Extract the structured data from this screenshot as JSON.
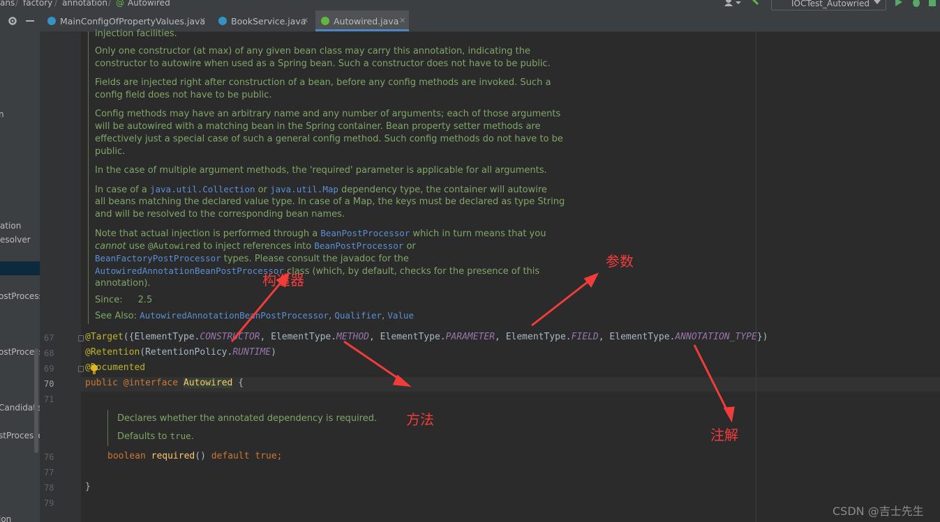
{
  "breadcrumb": [
    "ans",
    "factory",
    "annotation",
    "Autowired"
  ],
  "run_config": "IOCTest_Autowried",
  "tabs": [
    {
      "label": "MainConfigOfPropertyValues.java",
      "icon_color": "#3592c4",
      "active": false
    },
    {
      "label": "BookService.java",
      "icon_color": "#3592c4",
      "active": false
    },
    {
      "label": "Autowired.java",
      "icon_color": "#62b543",
      "active": true
    }
  ],
  "project_panel": {
    "items": [
      "n",
      "ation",
      "esolver",
      "ostProcesso",
      "ostProcesso",
      "CandidateR",
      "stProcesso",
      "ion"
    ]
  },
  "javadoc": {
    "line0": "injection facilities.",
    "p1": [
      "Only one constructor (at max) of any given bean class may carry this annotation, indicating the",
      "constructor to autowire when used as a Spring bean. Such a constructor does not have to be public."
    ],
    "p2": [
      "Fields are injected right after construction of a bean, before any config methods are invoked. Such a",
      "config field does not have to be public."
    ],
    "p3": [
      "Config methods may have an arbitrary name and any number of arguments; each of those arguments",
      "will be autowired with a matching bean in the Spring container. Bean property setter methods are",
      "effectively just a special case of such a general config method. Such config methods do not have to be",
      "public."
    ],
    "p4": "In the case of multiple argument methods, the 'required' parameter is applicable for all arguments.",
    "p5": {
      "a": "In case of a ",
      "b": "java.util.Collection",
      "c": " or ",
      "d": "java.util.Map",
      "e": " dependency type, the container will autowire",
      "l2": "all beans matching the declared value type. In case of a Map, the keys must be declared as type String",
      "l3": "and will be resolved to the corresponding bean names."
    },
    "p6": {
      "a": "Note that actual injection is performed through a ",
      "b": "BeanPostProcessor",
      "c": " which in turn means that you",
      "d": "cannot",
      "e": " use ",
      "f": "@Autowired",
      "g": " to inject references into ",
      "h": "BeanPostProcessor",
      "i": " or",
      "j": "BeanFactoryPostProcessor",
      "k": " types. Please consult the javadoc for the",
      "l": "AutowiredAnnotationBeanPostProcessor",
      "m": " class (which, by default, checks for the presence of this",
      "n": "annotation)."
    },
    "since_label": "Since:",
    "since_value": "2.5",
    "see_label": "See Also:",
    "see_links": [
      "AutowiredAnnotationBeanPostProcessor",
      "Qualifier",
      "Value"
    ]
  },
  "code": {
    "line_numbers": [
      "67",
      "68",
      "69",
      "70",
      "71",
      "76",
      "77",
      "78",
      "79"
    ],
    "target_annotation": "@Target",
    "target_open": "({",
    "etype": "ElementType.",
    "constructor": "CONSTRUCTOR",
    "method": "METHOD",
    "parameter": "PARAMETER",
    "field": "FIELD",
    "annotation_type": "ANNOTATION_TYPE",
    "comma": ", ",
    "target_close": "})",
    "retention_annotation": "@Retention",
    "retention_args_a": "(RetentionPolicy.",
    "runtime": "RUNTIME",
    "retention_args_b": ")",
    "documented": "@Documented",
    "public_kw": "public",
    "interface_kw": "@interface",
    "interface_name": "Autowired",
    "open_brace": "{",
    "inner_doc1": "Declares whether the annotated dependency is required.",
    "inner_doc2_a": "Defaults to ",
    "inner_doc2_b": "true",
    "inner_doc2_c": ".",
    "boolean_kw": "boolean",
    "method_name": "required",
    "method_parens": "()",
    "default_kw": "default",
    "true_kw": "true",
    "semicolon": ";",
    "close_brace": "}"
  },
  "red_annotations": {
    "constructor": "构造器",
    "parameter": "参数",
    "method": "方法",
    "annotation": "注解"
  },
  "watermark": "CSDN @吉士先生"
}
